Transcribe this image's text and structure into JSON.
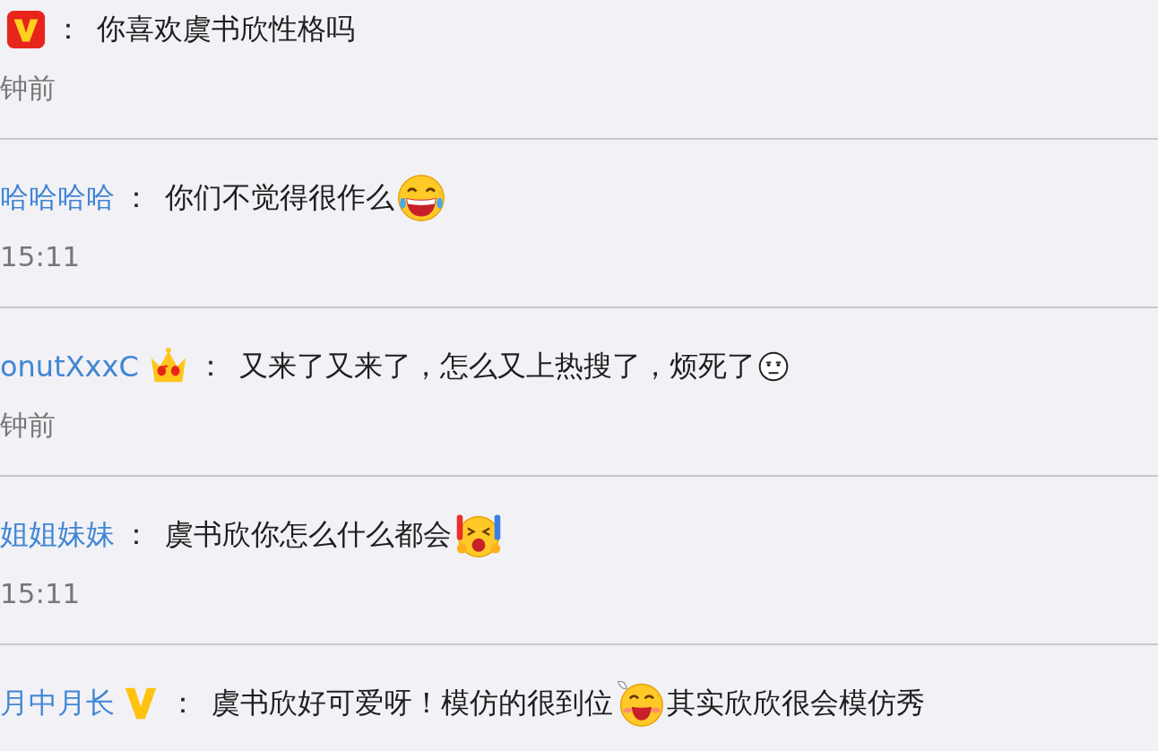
{
  "comments": [
    {
      "badge": {
        "kind": "red-v"
      },
      "sep": "：",
      "message": [
        {
          "kind": "text",
          "text": "你喜欢虞书欣性格吗"
        }
      ],
      "time": "钟前"
    },
    {
      "user": "哈哈哈哈",
      "sep": "：",
      "message": [
        {
          "kind": "text",
          "text": "你们不觉得很作么"
        },
        {
          "kind": "laugh"
        }
      ],
      "time": "15:11"
    },
    {
      "user": "onutXxxC",
      "badge": {
        "kind": "crown"
      },
      "sep": "：",
      "message": [
        {
          "kind": "text",
          "text": "又来了又来了，怎么又上热搜了，烦死了"
        },
        {
          "kind": "meh"
        }
      ],
      "time": "钟前"
    },
    {
      "user": "姐姐妹妹",
      "sep": "：",
      "message": [
        {
          "kind": "text",
          "text": "虞书欣你怎么什么都会"
        },
        {
          "kind": "cheer"
        }
      ],
      "time": "15:11"
    },
    {
      "user": "月中月长",
      "badge": {
        "kind": "gold-v"
      },
      "sep": "：",
      "message": [
        {
          "kind": "text",
          "text": "虞书欣好可爱呀！模仿的很到位"
        },
        {
          "kind": "grin"
        },
        {
          "kind": "text",
          "text": "其实欣欣很会模仿秀"
        }
      ]
    }
  ]
}
